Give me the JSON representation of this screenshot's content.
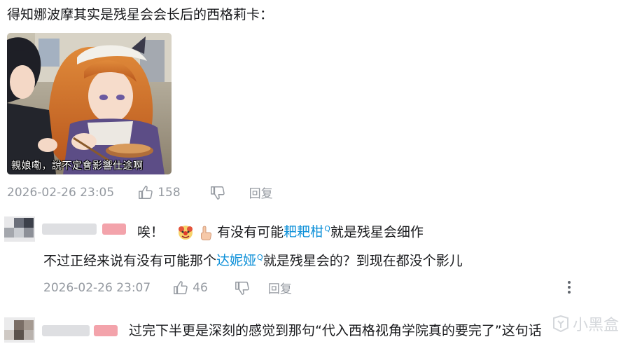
{
  "post": {
    "text": "得知娜波摩其实是残星会会长后的西格莉卡：",
    "image_caption": "親娘嘞，說不定會影響仕途啊",
    "date": "2026-02-26 23:05",
    "likes": "158",
    "reply_label": "回复"
  },
  "comment1": {
    "line1_prefix": "唉！",
    "line1_mid": "有没有可能",
    "link1": "耙耙柑",
    "line1_suffix": "就是残星会细作",
    "line2_prefix": "不过正经来说有没有可能那个",
    "link2": "达妮娅",
    "line2_suffix": "就是残星会的？到现在都没个影儿",
    "search_mark": "Q",
    "date": "2026-02-26 23:07",
    "likes": "46",
    "reply_label": "回复"
  },
  "comment2": {
    "text": "过完下半更是深刻的感觉到那句“代入西格视角学院真的要完了”这句话"
  },
  "watermark": {
    "text": "小黑盒"
  },
  "colors": {
    "link": "#0b8fd8",
    "meta": "#9499a0",
    "text": "#18191c"
  }
}
